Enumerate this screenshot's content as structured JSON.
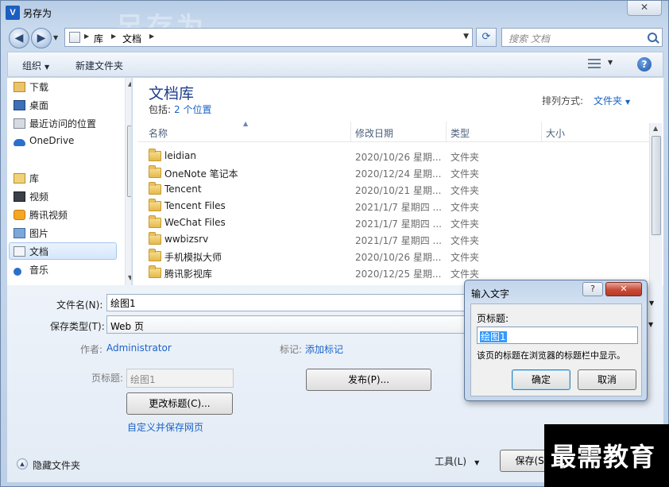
{
  "window": {
    "title": "另存为",
    "app_icon_letter": "V",
    "bg_watermark": "另存为",
    "close_label": "✕"
  },
  "nav": {
    "back_glyph": "◀",
    "forward_glyph": "▶",
    "path": [
      "库",
      "文档"
    ],
    "refresh_glyph": "⟳",
    "search_placeholder": "搜索 文档"
  },
  "toolbar": {
    "organize": "组织",
    "new_folder": "新建文件夹",
    "help": "?"
  },
  "sidebar": {
    "items": [
      {
        "label": "下载",
        "icon": "download-icon"
      },
      {
        "label": "桌面",
        "icon": "desktop-icon"
      },
      {
        "label": "最近访问的位置",
        "icon": "recent-places-icon"
      },
      {
        "label": "OneDrive",
        "icon": "onedrive-icon"
      },
      {
        "label": "库",
        "icon": "library-icon"
      },
      {
        "label": "视频",
        "icon": "video-icon"
      },
      {
        "label": "腾讯视频",
        "icon": "tencent-video-icon"
      },
      {
        "label": "图片",
        "icon": "pictures-icon"
      },
      {
        "label": "文档",
        "icon": "documents-icon",
        "selected": true
      },
      {
        "label": "音乐",
        "icon": "music-icon"
      }
    ]
  },
  "library": {
    "title": "文档库",
    "includes_label": "包括:",
    "includes_link": "2 个位置",
    "arrange_label": "排列方式:",
    "arrange_value": "文件夹"
  },
  "columns": {
    "name": "名称",
    "date": "修改日期",
    "type": "类型",
    "size": "大小"
  },
  "files": [
    {
      "name": "leidian",
      "date": "2020/10/26 星期...",
      "type": "文件夹"
    },
    {
      "name": "OneNote 笔记本",
      "date": "2020/12/24 星期...",
      "type": "文件夹"
    },
    {
      "name": "Tencent",
      "date": "2020/10/21 星期...",
      "type": "文件夹"
    },
    {
      "name": "Tencent Files",
      "date": "2021/1/7 星期四 ...",
      "type": "文件夹"
    },
    {
      "name": "WeChat Files",
      "date": "2021/1/7 星期四 ...",
      "type": "文件夹"
    },
    {
      "name": "wwbizsrv",
      "date": "2021/1/7 星期四 ...",
      "type": "文件夹"
    },
    {
      "name": "手机模拟大师",
      "date": "2020/10/26 星期...",
      "type": "文件夹"
    },
    {
      "name": "腾讯影视库",
      "date": "2020/12/25 星期...",
      "type": "文件夹"
    }
  ],
  "form": {
    "filename_label": "文件名(N):",
    "filename_value": "绘图1",
    "savetype_label": "保存类型(T):",
    "savetype_value": "Web 页",
    "author_label": "作者:",
    "author_value": "Administrator",
    "tags_label": "标记:",
    "tags_value": "添加标记",
    "page_title_label": "页标题:",
    "page_title_value": "绘图1",
    "change_title_btn": "更改标题(C)...",
    "publish_btn": "发布(P)...",
    "customize_link": "自定义并保存网页",
    "hide_folders": "隐藏文件夹",
    "tools_btn": "工具(L)",
    "save_btn": "保存(S)"
  },
  "dialog": {
    "title": "输入文字",
    "help": "?",
    "close": "✕",
    "label": "页标题:",
    "value": "绘图1",
    "hint": "该页的标题在浏览器的标题栏中显示。",
    "ok": "确定",
    "cancel": "取消"
  },
  "watermark_logo": "最需教育"
}
